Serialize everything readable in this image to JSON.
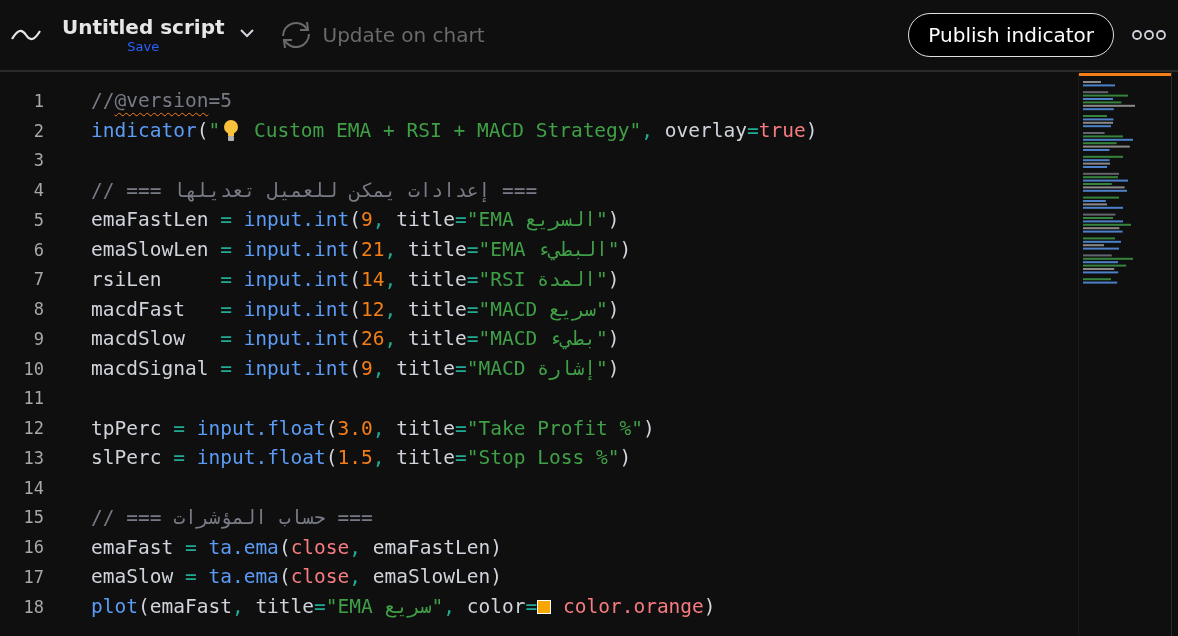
{
  "header": {
    "title": "Untitled script",
    "save_link": "Save",
    "update_button": {
      "label": "Update on chart",
      "disabled": true
    },
    "publish_button": "Publish indicator"
  },
  "editor": {
    "lines": [
      {
        "number": "1",
        "tokens": [
          {
            "kind": "comment",
            "text": "//"
          },
          {
            "kind": "warning",
            "text": "@version"
          },
          {
            "kind": "comment",
            "text": "=5"
          }
        ]
      },
      {
        "number": "2",
        "tokens": [
          {
            "kind": "func",
            "text": "indicator"
          },
          {
            "kind": "punc",
            "text": "("
          },
          {
            "kind": "str",
            "text": "\""
          },
          {
            "kind": "bulb"
          },
          {
            "kind": "str",
            "text": " Custom EMA + RSI + MACD Strategy\""
          },
          {
            "kind": "op",
            "text": ","
          },
          {
            "kind": "plain",
            "text": " overlay"
          },
          {
            "kind": "op",
            "text": "="
          },
          {
            "kind": "var",
            "text": "true"
          },
          {
            "kind": "punc",
            "text": ")"
          }
        ]
      },
      {
        "number": "3"
      },
      {
        "number": "4",
        "tokens": [
          {
            "kind": "comment",
            "text": "// === إعدادات يمكن للعميل تعديلها ==="
          }
        ]
      },
      {
        "number": "5",
        "tokens": [
          {
            "kind": "plain",
            "text": "emaFastLen"
          },
          {
            "kind": "op",
            "text": " = "
          },
          {
            "kind": "func",
            "text": "input.int"
          },
          {
            "kind": "punc",
            "text": "("
          },
          {
            "kind": "num",
            "text": "9"
          },
          {
            "kind": "op",
            "text": ","
          },
          {
            "kind": "plain",
            "text": " title"
          },
          {
            "kind": "op",
            "text": "="
          },
          {
            "kind": "str",
            "text": "\"EMA السريع\""
          },
          {
            "kind": "punc",
            "text": ")"
          }
        ]
      },
      {
        "number": "6",
        "tokens": [
          {
            "kind": "plain",
            "text": "emaSlowLen"
          },
          {
            "kind": "op",
            "text": " = "
          },
          {
            "kind": "func",
            "text": "input.int"
          },
          {
            "kind": "punc",
            "text": "("
          },
          {
            "kind": "num",
            "text": "21"
          },
          {
            "kind": "op",
            "text": ","
          },
          {
            "kind": "plain",
            "text": " title"
          },
          {
            "kind": "op",
            "text": "="
          },
          {
            "kind": "str",
            "text": "\"EMA البطيء\""
          },
          {
            "kind": "punc",
            "text": ")"
          }
        ]
      },
      {
        "number": "7",
        "tokens": [
          {
            "kind": "plain",
            "text": "rsiLen"
          },
          {
            "kind": "op",
            "text": "     = "
          },
          {
            "kind": "func",
            "text": "input.int"
          },
          {
            "kind": "punc",
            "text": "("
          },
          {
            "kind": "num",
            "text": "14"
          },
          {
            "kind": "op",
            "text": ","
          },
          {
            "kind": "plain",
            "text": " title"
          },
          {
            "kind": "op",
            "text": "="
          },
          {
            "kind": "str",
            "text": "\"RSI المدة\""
          },
          {
            "kind": "punc",
            "text": ")"
          }
        ]
      },
      {
        "number": "8",
        "tokens": [
          {
            "kind": "plain",
            "text": "macdFast"
          },
          {
            "kind": "op",
            "text": "   = "
          },
          {
            "kind": "func",
            "text": "input.int"
          },
          {
            "kind": "punc",
            "text": "("
          },
          {
            "kind": "num",
            "text": "12"
          },
          {
            "kind": "op",
            "text": ","
          },
          {
            "kind": "plain",
            "text": " title"
          },
          {
            "kind": "op",
            "text": "="
          },
          {
            "kind": "str",
            "text": "\"MACD سريع\""
          },
          {
            "kind": "punc",
            "text": ")"
          }
        ]
      },
      {
        "number": "9",
        "tokens": [
          {
            "kind": "plain",
            "text": "macdSlow"
          },
          {
            "kind": "op",
            "text": "   = "
          },
          {
            "kind": "func",
            "text": "input.int"
          },
          {
            "kind": "punc",
            "text": "("
          },
          {
            "kind": "num",
            "text": "26"
          },
          {
            "kind": "op",
            "text": ","
          },
          {
            "kind": "plain",
            "text": " title"
          },
          {
            "kind": "op",
            "text": "="
          },
          {
            "kind": "str",
            "text": "\"MACD بطيء\""
          },
          {
            "kind": "punc",
            "text": ")"
          }
        ]
      },
      {
        "number": "10",
        "tokens": [
          {
            "kind": "plain",
            "text": "macdSignal"
          },
          {
            "kind": "op",
            "text": " = "
          },
          {
            "kind": "func",
            "text": "input.int"
          },
          {
            "kind": "punc",
            "text": "("
          },
          {
            "kind": "num",
            "text": "9"
          },
          {
            "kind": "op",
            "text": ","
          },
          {
            "kind": "plain",
            "text": " title"
          },
          {
            "kind": "op",
            "text": "="
          },
          {
            "kind": "str",
            "text": "\"MACD إشارة\""
          },
          {
            "kind": "punc",
            "text": ")"
          }
        ]
      },
      {
        "number": "11"
      },
      {
        "number": "12",
        "tokens": [
          {
            "kind": "plain",
            "text": "tpPerc"
          },
          {
            "kind": "op",
            "text": " = "
          },
          {
            "kind": "func",
            "text": "input.float"
          },
          {
            "kind": "punc",
            "text": "("
          },
          {
            "kind": "num",
            "text": "3.0"
          },
          {
            "kind": "op",
            "text": ","
          },
          {
            "kind": "plain",
            "text": " title"
          },
          {
            "kind": "op",
            "text": "="
          },
          {
            "kind": "str",
            "text": "\"Take Profit %\""
          },
          {
            "kind": "punc",
            "text": ")"
          }
        ]
      },
      {
        "number": "13",
        "tokens": [
          {
            "kind": "plain",
            "text": "slPerc"
          },
          {
            "kind": "op",
            "text": " = "
          },
          {
            "kind": "func",
            "text": "input.float"
          },
          {
            "kind": "punc",
            "text": "("
          },
          {
            "kind": "num",
            "text": "1.5"
          },
          {
            "kind": "op",
            "text": ","
          },
          {
            "kind": "plain",
            "text": " title"
          },
          {
            "kind": "op",
            "text": "="
          },
          {
            "kind": "str",
            "text": "\"Stop Loss %\""
          },
          {
            "kind": "punc",
            "text": ")"
          }
        ]
      },
      {
        "number": "14"
      },
      {
        "number": "15",
        "tokens": [
          {
            "kind": "comment",
            "text": "// === حساب المؤشرات ==="
          }
        ]
      },
      {
        "number": "16",
        "tokens": [
          {
            "kind": "plain",
            "text": "emaFast"
          },
          {
            "kind": "op",
            "text": " = "
          },
          {
            "kind": "func",
            "text": "ta.ema"
          },
          {
            "kind": "punc",
            "text": "("
          },
          {
            "kind": "var",
            "text": "close"
          },
          {
            "kind": "op",
            "text": ","
          },
          {
            "kind": "plain",
            "text": " emaFastLen)"
          }
        ]
      },
      {
        "number": "17",
        "tokens": [
          {
            "kind": "plain",
            "text": "emaSlow"
          },
          {
            "kind": "op",
            "text": " = "
          },
          {
            "kind": "func",
            "text": "ta.ema"
          },
          {
            "kind": "punc",
            "text": "("
          },
          {
            "kind": "var",
            "text": "close"
          },
          {
            "kind": "op",
            "text": ","
          },
          {
            "kind": "plain",
            "text": " emaSlowLen)"
          }
        ]
      },
      {
        "number": "18",
        "tokens": [
          {
            "kind": "func",
            "text": "plot"
          },
          {
            "kind": "punc",
            "text": "(emaFast"
          },
          {
            "kind": "op",
            "text": ","
          },
          {
            "kind": "plain",
            "text": " title"
          },
          {
            "kind": "op",
            "text": "="
          },
          {
            "kind": "str",
            "text": "\"EMA سريع\""
          },
          {
            "kind": "op",
            "text": ","
          },
          {
            "kind": "plain",
            "text": " color"
          },
          {
            "kind": "op",
            "text": "="
          },
          {
            "kind": "swatch",
            "color": "#f7a600"
          },
          {
            "kind": "var",
            "text": " color.orange"
          },
          {
            "kind": "punc",
            "text": ")"
          }
        ]
      }
    ]
  }
}
